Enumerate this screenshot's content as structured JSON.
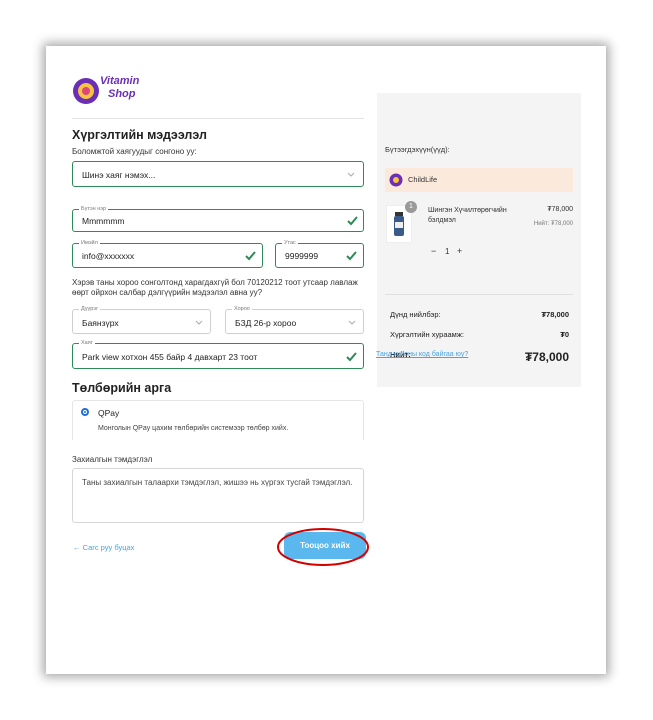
{
  "brand": {
    "logo_text_line1": "Vitamin",
    "logo_text_line2": "Shop",
    "accent_color": "#6a2fb5"
  },
  "delivery": {
    "section_title": "Хүргэлтийн мэдээлэл",
    "address_select_label": "Боломжтой хаягуудыг сонгоно уу:",
    "address_select_value": "Шинэ хаяг нэмэх...",
    "name_label": "Бүтэн нэр",
    "name_value": "Mmmmmm",
    "email_label": "Имэйл",
    "email_value": "info@xxxxxxx",
    "phone_label": "Утас",
    "phone_value": "9999999",
    "note": "Хэрэв таны хороо сонголтонд харагдахгүй бол 70120212 тоот утсаар лавлаж өөрт ойрхон салбар дэлгүүрийн мэдээлэл авна уу?",
    "district_label": "Дүүрэг",
    "district_value": "Баянзүрх",
    "khoroo_label": "Хороо",
    "khoroo_value": "БЗД 26-р хороо",
    "address_label": "Хаяг",
    "address_value": "Park view хотхон 455 байр 4 давхарт 23 тоот"
  },
  "payment": {
    "section_title": "Төлбөрийн арга",
    "method_name": "QPay",
    "method_desc": "Монголын QPay цахим төлбөрийн системээр төлбөр хийх."
  },
  "order_note": {
    "label": "Захиалгын тэмдэглэл",
    "placeholder": "Таны захиалгын талаархи тэмдэглэл, жишээ нь хүргэх тусгай тэмдэглэл."
  },
  "actions": {
    "back_link": "← Сагс руу буцах",
    "submit_button": "Тооцоо хийх",
    "highlight_color": "#d40000"
  },
  "summary": {
    "products_label": "Бүтээгдэхүүн(үүд):",
    "store_name": "ChildLife",
    "store_bg": "#fbeadb",
    "item": {
      "badge_count": "1",
      "name": "Шингэн Хүчилтөрөгчийн бэлдмэл",
      "price": "₮78,000",
      "total_label": "Нийт: ₮78,000",
      "qty": "1",
      "minus": "−",
      "plus": "+"
    },
    "subtotal_label": "Дүнд нийлбэр:",
    "subtotal_value": "₮78,000",
    "shipping_label": "Хүргэлтийн хураамж:",
    "shipping_value": "₮0",
    "total_label": "Нийт:",
    "total_value": "₮78,000",
    "coupon_link": "Танд купоны код байгаа юу?"
  }
}
